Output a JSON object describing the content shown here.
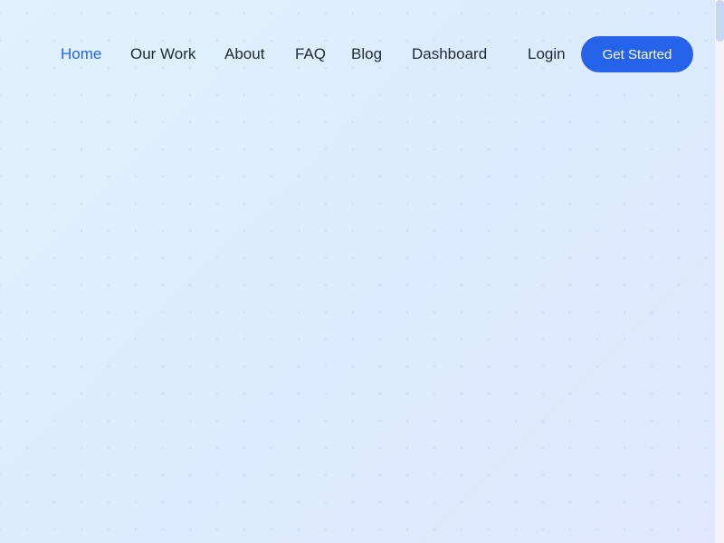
{
  "nav": {
    "items": [
      {
        "label": "Home",
        "active": true
      },
      {
        "label": "Our Work"
      },
      {
        "label": "About"
      },
      {
        "label": "FAQ"
      },
      {
        "label": "Blog"
      },
      {
        "label": "Dashboard"
      }
    ],
    "login_label": "Login",
    "cta_label": "Get Started"
  },
  "colors": {
    "accent": "#2563eb",
    "text": "#1f2937"
  }
}
